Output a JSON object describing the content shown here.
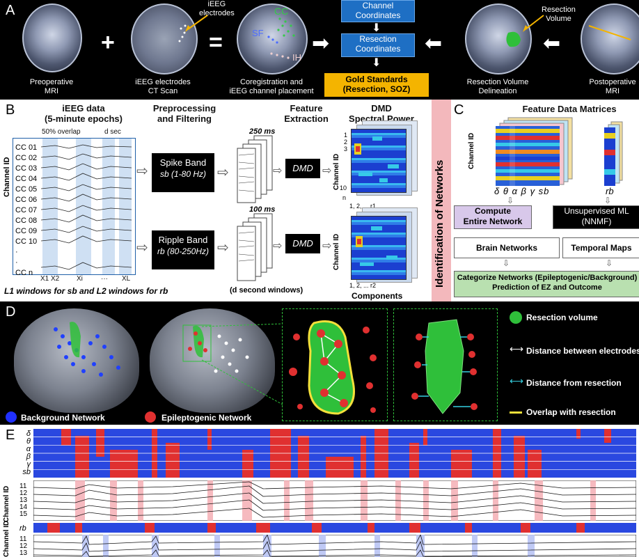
{
  "panelA": {
    "letter": "A",
    "preop": "Preoperative\nMRI",
    "ct": "iEEG electrodes\nCT Scan",
    "ieeg_electrodes": "iEEG\nelectrodes",
    "cc": "CC",
    "sf": "SF",
    "ih": "IH",
    "coreg": "Coregistration and\niEEG channel placement",
    "channel_coords": "Channel\nCoordinates",
    "resection_coords": "Resection\nCoordinates",
    "gold": "Gold Standards\n(Resection, SOZ)",
    "resection_volume": "Resection\nVolume",
    "delineation": "Resection Volume\nDelineation",
    "postop": "Postoperative\nMRI"
  },
  "panelB": {
    "letter": "B",
    "ieeg_title": "iEEG data\n(5-minute epochs)",
    "preproc": "Preprocessing\nand Filtering",
    "feature": "Feature\nExtraction",
    "dmd": "DMD\nSpectral Power",
    "overlap": "50% overlap",
    "dsec": "d sec",
    "channel_id": "Channel ID",
    "channels": [
      "CC 01",
      "CC 02",
      "CC 03",
      "CC 04",
      "CC 05",
      "CC 06",
      "CC 07",
      "CC 08",
      "CC 09",
      "CC 10",
      "·",
      "·",
      "CC  n"
    ],
    "xlabels": [
      "X1 X2",
      "Xi",
      "···",
      "XL"
    ],
    "spike_title": "Spike Band",
    "spike_sub": "sb (1-80 Hz)",
    "ripple_title": "Ripple Band",
    "ripple_sub": "rb (80-250Hz)",
    "ms250": "250 ms",
    "ms100": "100 ms",
    "dmd1": "DMD",
    "dmd2": "DMD",
    "windows_note": "L1 windows for sb and L2 windows for rb",
    "dsec_windows": "(d second windows)",
    "components": "Components",
    "heat_ylabel": "Channel ID",
    "heat_ticks1": [
      "1",
      "2",
      "3",
      "10",
      "n"
    ],
    "heat_xticks": "1, 2,      ...      r1",
    "heat_xticks2": "1, 2,      ...      r2"
  },
  "identification": "Identification of Networks",
  "panelC": {
    "letter": "C",
    "title": "Feature Data Matrices",
    "ylabel": "Channel ID",
    "bands": "δ  θ  α  β  γ  sb",
    "rb": "rb",
    "compute": "Compute\nEntire Network",
    "nnmf": "Unsupervised ML\n(NNMF)",
    "brain_networks": "Brain Networks",
    "temporal_maps": "Temporal Maps",
    "categorize": "Categorize Networks (Epileptogenic/Background)\nPrediction of EZ and Outcome"
  },
  "panelD": {
    "letter": "D",
    "legend": [
      {
        "label": "Resection volume"
      },
      {
        "label": "Distance between electrodes"
      },
      {
        "label": "Distance from resection"
      },
      {
        "label": "Overlap with resection"
      }
    ],
    "background_network": "Background Network",
    "epileptogenic_network": "Epileptogenic  Network"
  },
  "panelE": {
    "letter": "E",
    "band_labels": [
      "δ",
      "θ",
      "α",
      "β",
      "γ",
      "sb"
    ],
    "channel_id": "Channel ID",
    "channels": [
      "11",
      "12",
      "13",
      "14",
      "15"
    ],
    "rb": "rb",
    "channel_id2": "Channel ID",
    "channels2": [
      "11",
      "12",
      "13"
    ]
  },
  "colors": {
    "blue": "#1b3fd0",
    "red": "#e03030",
    "gold": "#f4b400",
    "panel_blue": "#1e6fc4",
    "pink": "#f4a9b0",
    "green": "#2fbf3a"
  }
}
